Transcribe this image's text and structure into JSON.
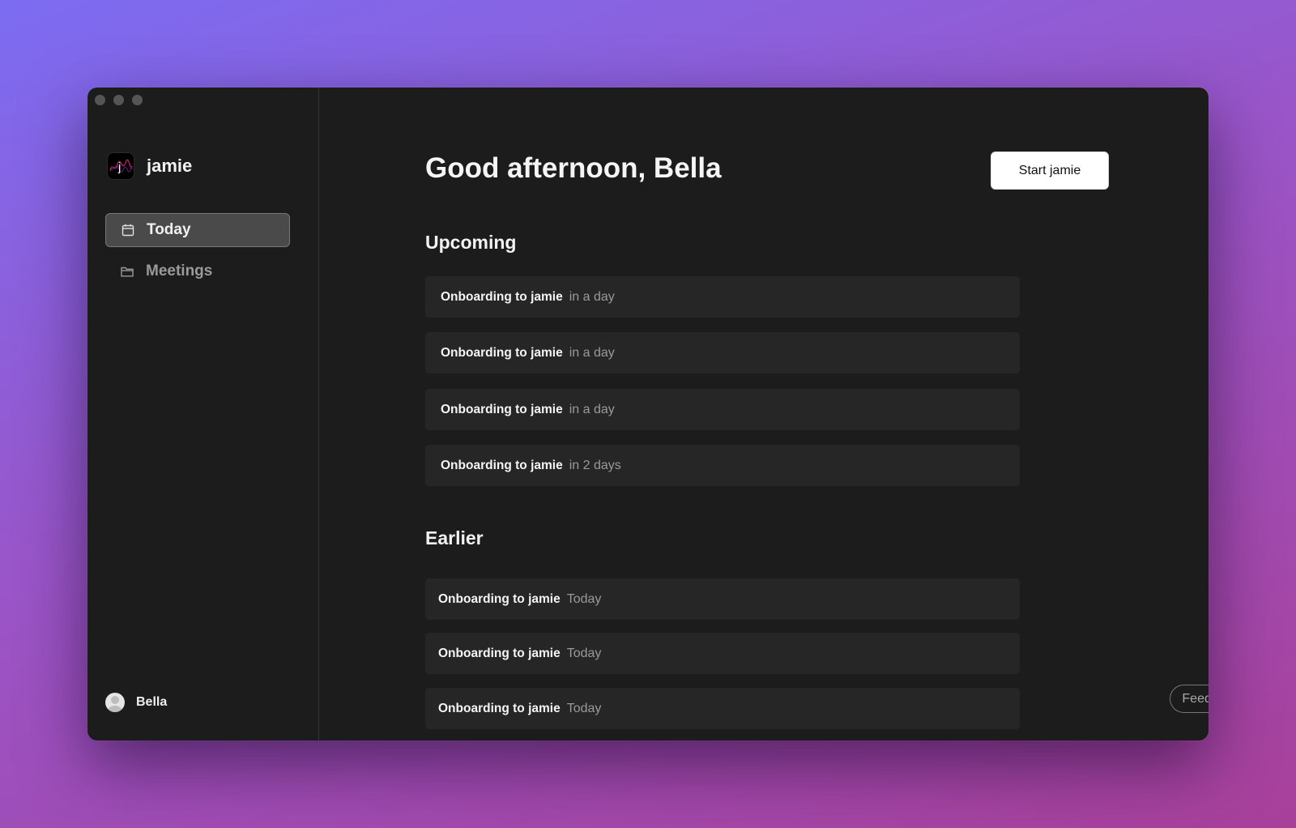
{
  "app": {
    "name": "jamie"
  },
  "sidebar": {
    "items": [
      {
        "label": "Today",
        "icon": "calendar-icon",
        "active": true
      },
      {
        "label": "Meetings",
        "icon": "folder-icon",
        "active": false
      }
    ],
    "user": {
      "name": "Bella",
      "icon": "avatar-icon"
    }
  },
  "main": {
    "greeting": "Good afternoon, Bella",
    "start_button": "Start jamie",
    "upcoming": {
      "title": "Upcoming",
      "items": [
        {
          "title": "Onboarding to jamie",
          "when": "in a day"
        },
        {
          "title": "Onboarding to jamie",
          "when": "in a day"
        },
        {
          "title": "Onboarding to jamie",
          "when": "in a day"
        },
        {
          "title": "Onboarding to jamie",
          "when": "in 2 days"
        }
      ]
    },
    "earlier": {
      "title": "Earlier",
      "items": [
        {
          "title": "Onboarding to jamie",
          "when": "Today"
        },
        {
          "title": "Onboarding to jamie",
          "when": "Today"
        },
        {
          "title": "Onboarding to jamie",
          "when": "Today"
        }
      ]
    },
    "feedback_button": "Feedback?"
  },
  "colors": {
    "window_bg": "#1c1c1c",
    "row_bg": "#262626",
    "active_nav_bg": "#4a4a4a",
    "muted_text": "#9a9a9a",
    "primary_button_bg": "#ffffff"
  }
}
